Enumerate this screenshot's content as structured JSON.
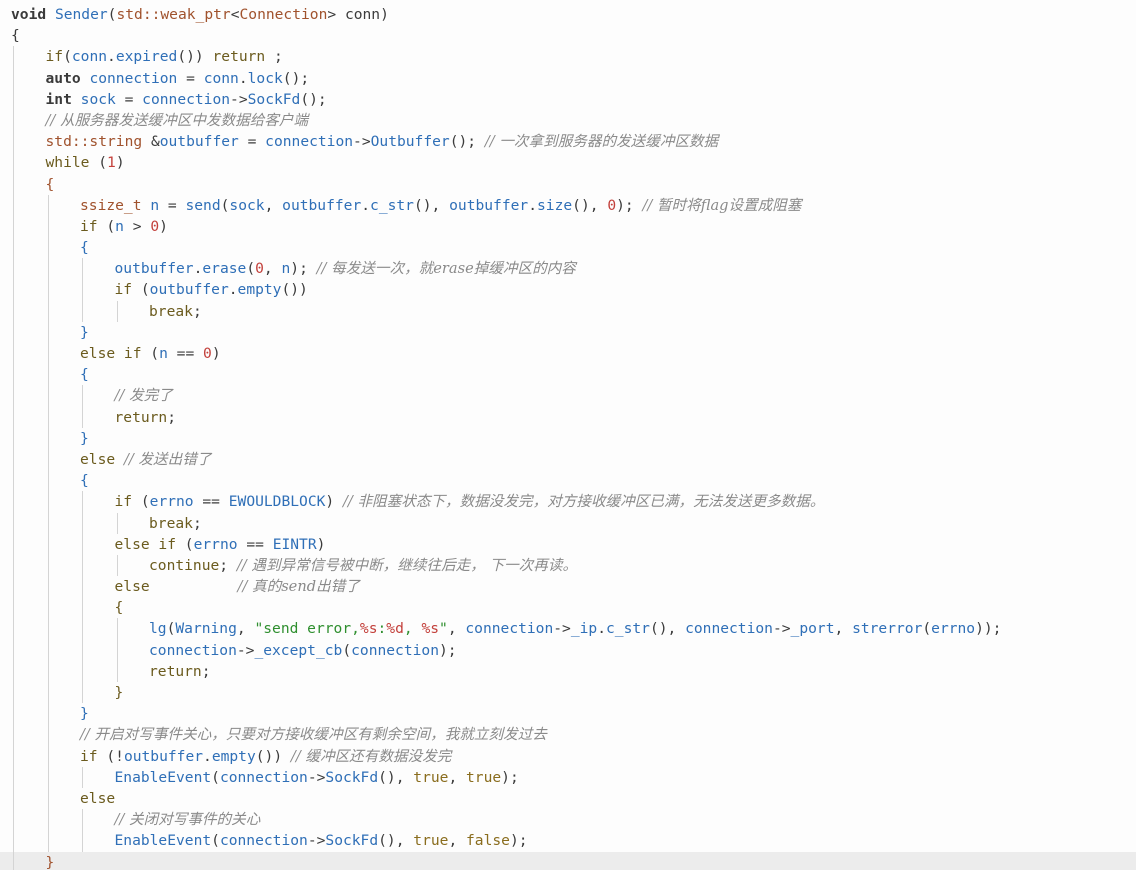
{
  "editor": {
    "colors": {
      "background": "#fdfdfd",
      "keyword": "#6b5b1e",
      "function": "#2f6fb7",
      "type": "#a0522d",
      "number": "#c3403b",
      "string": "#2f8f2f",
      "comment": "#8a8a8a",
      "current_line": "#ececec"
    },
    "lines": [
      {
        "indent": 0,
        "tokens": [
          [
            "kwb",
            "void"
          ],
          [
            "op",
            " "
          ],
          [
            "fn",
            "Sender"
          ],
          [
            "op",
            "("
          ],
          [
            "ty",
            "std::weak_ptr"
          ],
          [
            "op",
            "<"
          ],
          [
            "ty",
            "Connection"
          ],
          [
            "op",
            "> "
          ],
          [
            "op",
            "conn"
          ],
          [
            "op",
            ")"
          ]
        ]
      },
      {
        "indent": 0,
        "tokens": [
          [
            "op",
            "{"
          ]
        ]
      },
      {
        "indent": 1,
        "tokens": [
          [
            "kw",
            "if"
          ],
          [
            "op",
            "("
          ],
          [
            "var",
            "conn"
          ],
          [
            "op",
            "."
          ],
          [
            "fn",
            "expired"
          ],
          [
            "op",
            "()) "
          ],
          [
            "kw",
            "return"
          ],
          [
            "op",
            " ;"
          ]
        ]
      },
      {
        "indent": 1,
        "tokens": [
          [
            "kwb",
            "auto"
          ],
          [
            "op",
            " "
          ],
          [
            "var",
            "connection"
          ],
          [
            "op",
            " = "
          ],
          [
            "var",
            "conn"
          ],
          [
            "op",
            "."
          ],
          [
            "fn",
            "lock"
          ],
          [
            "op",
            "();"
          ]
        ]
      },
      {
        "indent": 1,
        "tokens": [
          [
            "kwb",
            "int"
          ],
          [
            "op",
            " "
          ],
          [
            "var",
            "sock"
          ],
          [
            "op",
            " = "
          ],
          [
            "var",
            "connection"
          ],
          [
            "op",
            "->"
          ],
          [
            "fn",
            "SockFd"
          ],
          [
            "op",
            "();"
          ]
        ]
      },
      {
        "indent": 1,
        "tokens": [
          [
            "cm",
            "// 从服务器发送缓冲区中发数据给客户端"
          ]
        ]
      },
      {
        "indent": 1,
        "tokens": [
          [
            "ty",
            "std::string"
          ],
          [
            "op",
            " &"
          ],
          [
            "var",
            "outbuffer"
          ],
          [
            "op",
            " = "
          ],
          [
            "var",
            "connection"
          ],
          [
            "op",
            "->"
          ],
          [
            "fn",
            "Outbuffer"
          ],
          [
            "op",
            "(); "
          ],
          [
            "cm",
            "// 一次拿到服务器的发送缓冲区数据"
          ]
        ]
      },
      {
        "indent": 1,
        "tokens": [
          [
            "kw",
            "while"
          ],
          [
            "op",
            " ("
          ],
          [
            "num",
            "1"
          ],
          [
            "op",
            ")"
          ]
        ]
      },
      {
        "indent": 1,
        "tokens": [
          [
            "ty",
            "{"
          ]
        ]
      },
      {
        "indent": 2,
        "tokens": [
          [
            "ty",
            "ssize_t"
          ],
          [
            "op",
            " "
          ],
          [
            "var",
            "n"
          ],
          [
            "op",
            " = "
          ],
          [
            "fn",
            "send"
          ],
          [
            "op",
            "("
          ],
          [
            "var",
            "sock"
          ],
          [
            "op",
            ", "
          ],
          [
            "var",
            "outbuffer"
          ],
          [
            "op",
            "."
          ],
          [
            "fn",
            "c_str"
          ],
          [
            "op",
            "(), "
          ],
          [
            "var",
            "outbuffer"
          ],
          [
            "op",
            "."
          ],
          [
            "fn",
            "size"
          ],
          [
            "op",
            "(), "
          ],
          [
            "num",
            "0"
          ],
          [
            "op",
            "); "
          ],
          [
            "cm",
            "// 暂时将flag设置成阻塞"
          ]
        ]
      },
      {
        "indent": 2,
        "tokens": [
          [
            "kw",
            "if"
          ],
          [
            "op",
            " ("
          ],
          [
            "var",
            "n"
          ],
          [
            "op",
            " > "
          ],
          [
            "num",
            "0"
          ],
          [
            "op",
            ")"
          ]
        ]
      },
      {
        "indent": 2,
        "tokens": [
          [
            "fn",
            "{"
          ]
        ]
      },
      {
        "indent": 3,
        "tokens": [
          [
            "var",
            "outbuffer"
          ],
          [
            "op",
            "."
          ],
          [
            "fn",
            "erase"
          ],
          [
            "op",
            "("
          ],
          [
            "num",
            "0"
          ],
          [
            "op",
            ", "
          ],
          [
            "var",
            "n"
          ],
          [
            "op",
            "); "
          ],
          [
            "cm",
            "// 每发送一次，就erase掉缓冲区的内容"
          ]
        ]
      },
      {
        "indent": 3,
        "tokens": [
          [
            "kw",
            "if"
          ],
          [
            "op",
            " ("
          ],
          [
            "var",
            "outbuffer"
          ],
          [
            "op",
            "."
          ],
          [
            "fn",
            "empty"
          ],
          [
            "op",
            "())"
          ]
        ]
      },
      {
        "indent": 4,
        "tokens": [
          [
            "kw",
            "break"
          ],
          [
            "op",
            ";"
          ]
        ]
      },
      {
        "indent": 2,
        "tokens": [
          [
            "fn",
            "}"
          ]
        ]
      },
      {
        "indent": 2,
        "tokens": [
          [
            "kw",
            "else if"
          ],
          [
            "op",
            " ("
          ],
          [
            "var",
            "n"
          ],
          [
            "op",
            " == "
          ],
          [
            "num",
            "0"
          ],
          [
            "op",
            ")"
          ]
        ]
      },
      {
        "indent": 2,
        "tokens": [
          [
            "fn",
            "{"
          ]
        ]
      },
      {
        "indent": 3,
        "tokens": [
          [
            "cm",
            "// 发完了"
          ]
        ]
      },
      {
        "indent": 3,
        "tokens": [
          [
            "kw",
            "return"
          ],
          [
            "op",
            ";"
          ]
        ]
      },
      {
        "indent": 2,
        "tokens": [
          [
            "fn",
            "}"
          ]
        ]
      },
      {
        "indent": 2,
        "tokens": [
          [
            "kw",
            "else"
          ],
          [
            "op",
            " "
          ],
          [
            "cm",
            "// 发送出错了"
          ]
        ]
      },
      {
        "indent": 2,
        "tokens": [
          [
            "fn",
            "{"
          ]
        ]
      },
      {
        "indent": 3,
        "tokens": [
          [
            "kw",
            "if"
          ],
          [
            "op",
            " ("
          ],
          [
            "var",
            "errno"
          ],
          [
            "op",
            " == "
          ],
          [
            "cn",
            "EWOULDBLOCK"
          ],
          [
            "op",
            ") "
          ],
          [
            "cm",
            "// 非阻塞状态下，数据没发完，对方接收缓冲区已满，无法发送更多数据。"
          ]
        ]
      },
      {
        "indent": 4,
        "tokens": [
          [
            "kw",
            "break"
          ],
          [
            "op",
            ";"
          ]
        ]
      },
      {
        "indent": 3,
        "tokens": [
          [
            "kw",
            "else if"
          ],
          [
            "op",
            " ("
          ],
          [
            "var",
            "errno"
          ],
          [
            "op",
            " == "
          ],
          [
            "cn",
            "EINTR"
          ],
          [
            "op",
            ")"
          ]
        ]
      },
      {
        "indent": 4,
        "tokens": [
          [
            "kw",
            "continue"
          ],
          [
            "op",
            "; "
          ],
          [
            "cm",
            "// 遇到异常信号被中断，继续往后走， 下一次再读。"
          ]
        ]
      },
      {
        "indent": 3,
        "tokens": [
          [
            "kw",
            "else"
          ],
          [
            "op",
            "          "
          ],
          [
            "cm",
            "// 真的send出错了"
          ]
        ]
      },
      {
        "indent": 3,
        "tokens": [
          [
            "kw",
            "{"
          ]
        ]
      },
      {
        "indent": 4,
        "tokens": [
          [
            "fn",
            "lg"
          ],
          [
            "op",
            "("
          ],
          [
            "cn",
            "Warning"
          ],
          [
            "op",
            ", "
          ],
          [
            "str",
            "\"send error,"
          ],
          [
            "fmt",
            "%s"
          ],
          [
            "str",
            ":"
          ],
          [
            "fmt",
            "%d"
          ],
          [
            "str",
            ", "
          ],
          [
            "fmt",
            "%s"
          ],
          [
            "str",
            "\""
          ],
          [
            "op",
            ", "
          ],
          [
            "var",
            "connection"
          ],
          [
            "op",
            "->"
          ],
          [
            "var",
            "_ip"
          ],
          [
            "op",
            "."
          ],
          [
            "fn",
            "c_str"
          ],
          [
            "op",
            "(), "
          ],
          [
            "var",
            "connection"
          ],
          [
            "op",
            "->"
          ],
          [
            "var",
            "_port"
          ],
          [
            "op",
            ", "
          ],
          [
            "fn",
            "strerror"
          ],
          [
            "op",
            "("
          ],
          [
            "var",
            "errno"
          ],
          [
            "op",
            "));"
          ]
        ]
      },
      {
        "indent": 4,
        "tokens": [
          [
            "var",
            "connection"
          ],
          [
            "op",
            "->"
          ],
          [
            "fn",
            "_except_cb"
          ],
          [
            "op",
            "("
          ],
          [
            "var",
            "connection"
          ],
          [
            "op",
            ");"
          ]
        ]
      },
      {
        "indent": 4,
        "tokens": [
          [
            "kw",
            "return"
          ],
          [
            "op",
            ";"
          ]
        ]
      },
      {
        "indent": 3,
        "tokens": [
          [
            "kw",
            "}"
          ]
        ]
      },
      {
        "indent": 2,
        "tokens": [
          [
            "fn",
            "}"
          ]
        ]
      },
      {
        "indent": 2,
        "tokens": [
          [
            "cm",
            "// 开启对写事件关心，只要对方接收缓冲区有剩余空间，我就立刻发过去"
          ]
        ]
      },
      {
        "indent": 2,
        "tokens": [
          [
            "kw",
            "if"
          ],
          [
            "op",
            " (!"
          ],
          [
            "var",
            "outbuffer"
          ],
          [
            "op",
            "."
          ],
          [
            "fn",
            "empty"
          ],
          [
            "op",
            "()) "
          ],
          [
            "cm",
            "// 缓冲区还有数据没发完"
          ]
        ]
      },
      {
        "indent": 3,
        "tokens": [
          [
            "fn",
            "EnableEvent"
          ],
          [
            "op",
            "("
          ],
          [
            "var",
            "connection"
          ],
          [
            "op",
            "->"
          ],
          [
            "fn",
            "SockFd"
          ],
          [
            "op",
            "(), "
          ],
          [
            "bool",
            "true"
          ],
          [
            "op",
            ", "
          ],
          [
            "bool",
            "true"
          ],
          [
            "op",
            ");"
          ]
        ]
      },
      {
        "indent": 2,
        "tokens": [
          [
            "kw",
            "else"
          ]
        ]
      },
      {
        "indent": 3,
        "tokens": [
          [
            "cm",
            "// 关闭对写事件的关心"
          ]
        ]
      },
      {
        "indent": 3,
        "tokens": [
          [
            "fn",
            "EnableEvent"
          ],
          [
            "op",
            "("
          ],
          [
            "var",
            "connection"
          ],
          [
            "op",
            "->"
          ],
          [
            "fn",
            "SockFd"
          ],
          [
            "op",
            "(), "
          ],
          [
            "bool",
            "true"
          ],
          [
            "op",
            ", "
          ],
          [
            "bool",
            "false"
          ],
          [
            "op",
            ");"
          ]
        ]
      },
      {
        "indent": 1,
        "current": true,
        "tokens": [
          [
            "ty",
            "}"
          ]
        ]
      }
    ]
  }
}
